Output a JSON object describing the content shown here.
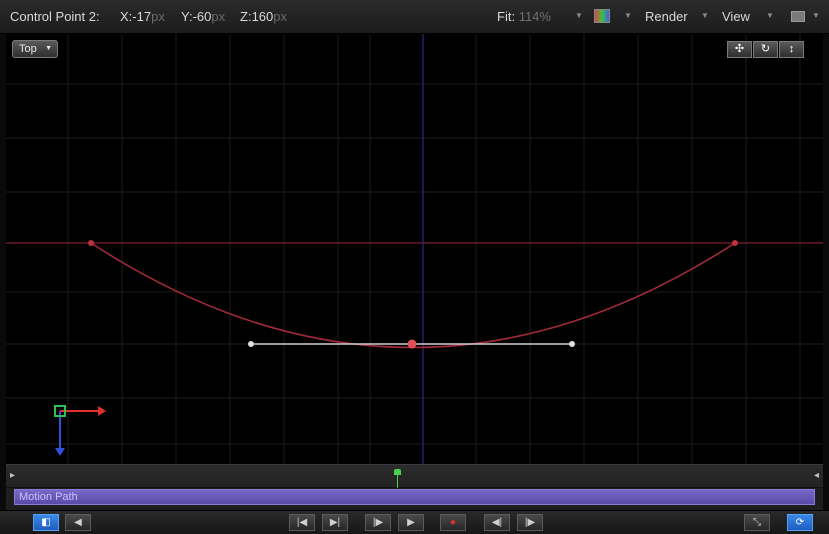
{
  "toolbar": {
    "control_point_label": "Control Point 2:",
    "x_label": "X:",
    "x_value": "-17",
    "y_label": "Y:",
    "y_value": "-60",
    "z_label": "Z:",
    "z_value": "160",
    "unit": "px",
    "fit_label": "Fit:",
    "fit_value": "114%",
    "render_label": "Render",
    "view_label": "View"
  },
  "canvas": {
    "view_popup_label": "Top",
    "accent_path_color": "#b03040",
    "handle_color": "#d0d0d0",
    "axis_x_color": "#e03030",
    "axis_y_color": "#3050e0",
    "axis_z_color": "#30c050"
  },
  "timeline": {
    "track_label": "Motion Path",
    "track_color": "#6a58c0"
  },
  "icons": [
    "pan-icon",
    "orbit-icon",
    "dolly-icon",
    "color-channels-icon",
    "layout-icon",
    "toggle-canvas-icon",
    "audio-icon",
    "go-to-start-icon",
    "play-from-start-icon",
    "step-back-icon",
    "play-icon",
    "record-icon",
    "previous-keyframe-icon",
    "next-keyframe-icon",
    "fullscreen-icon",
    "loop-icon"
  ]
}
